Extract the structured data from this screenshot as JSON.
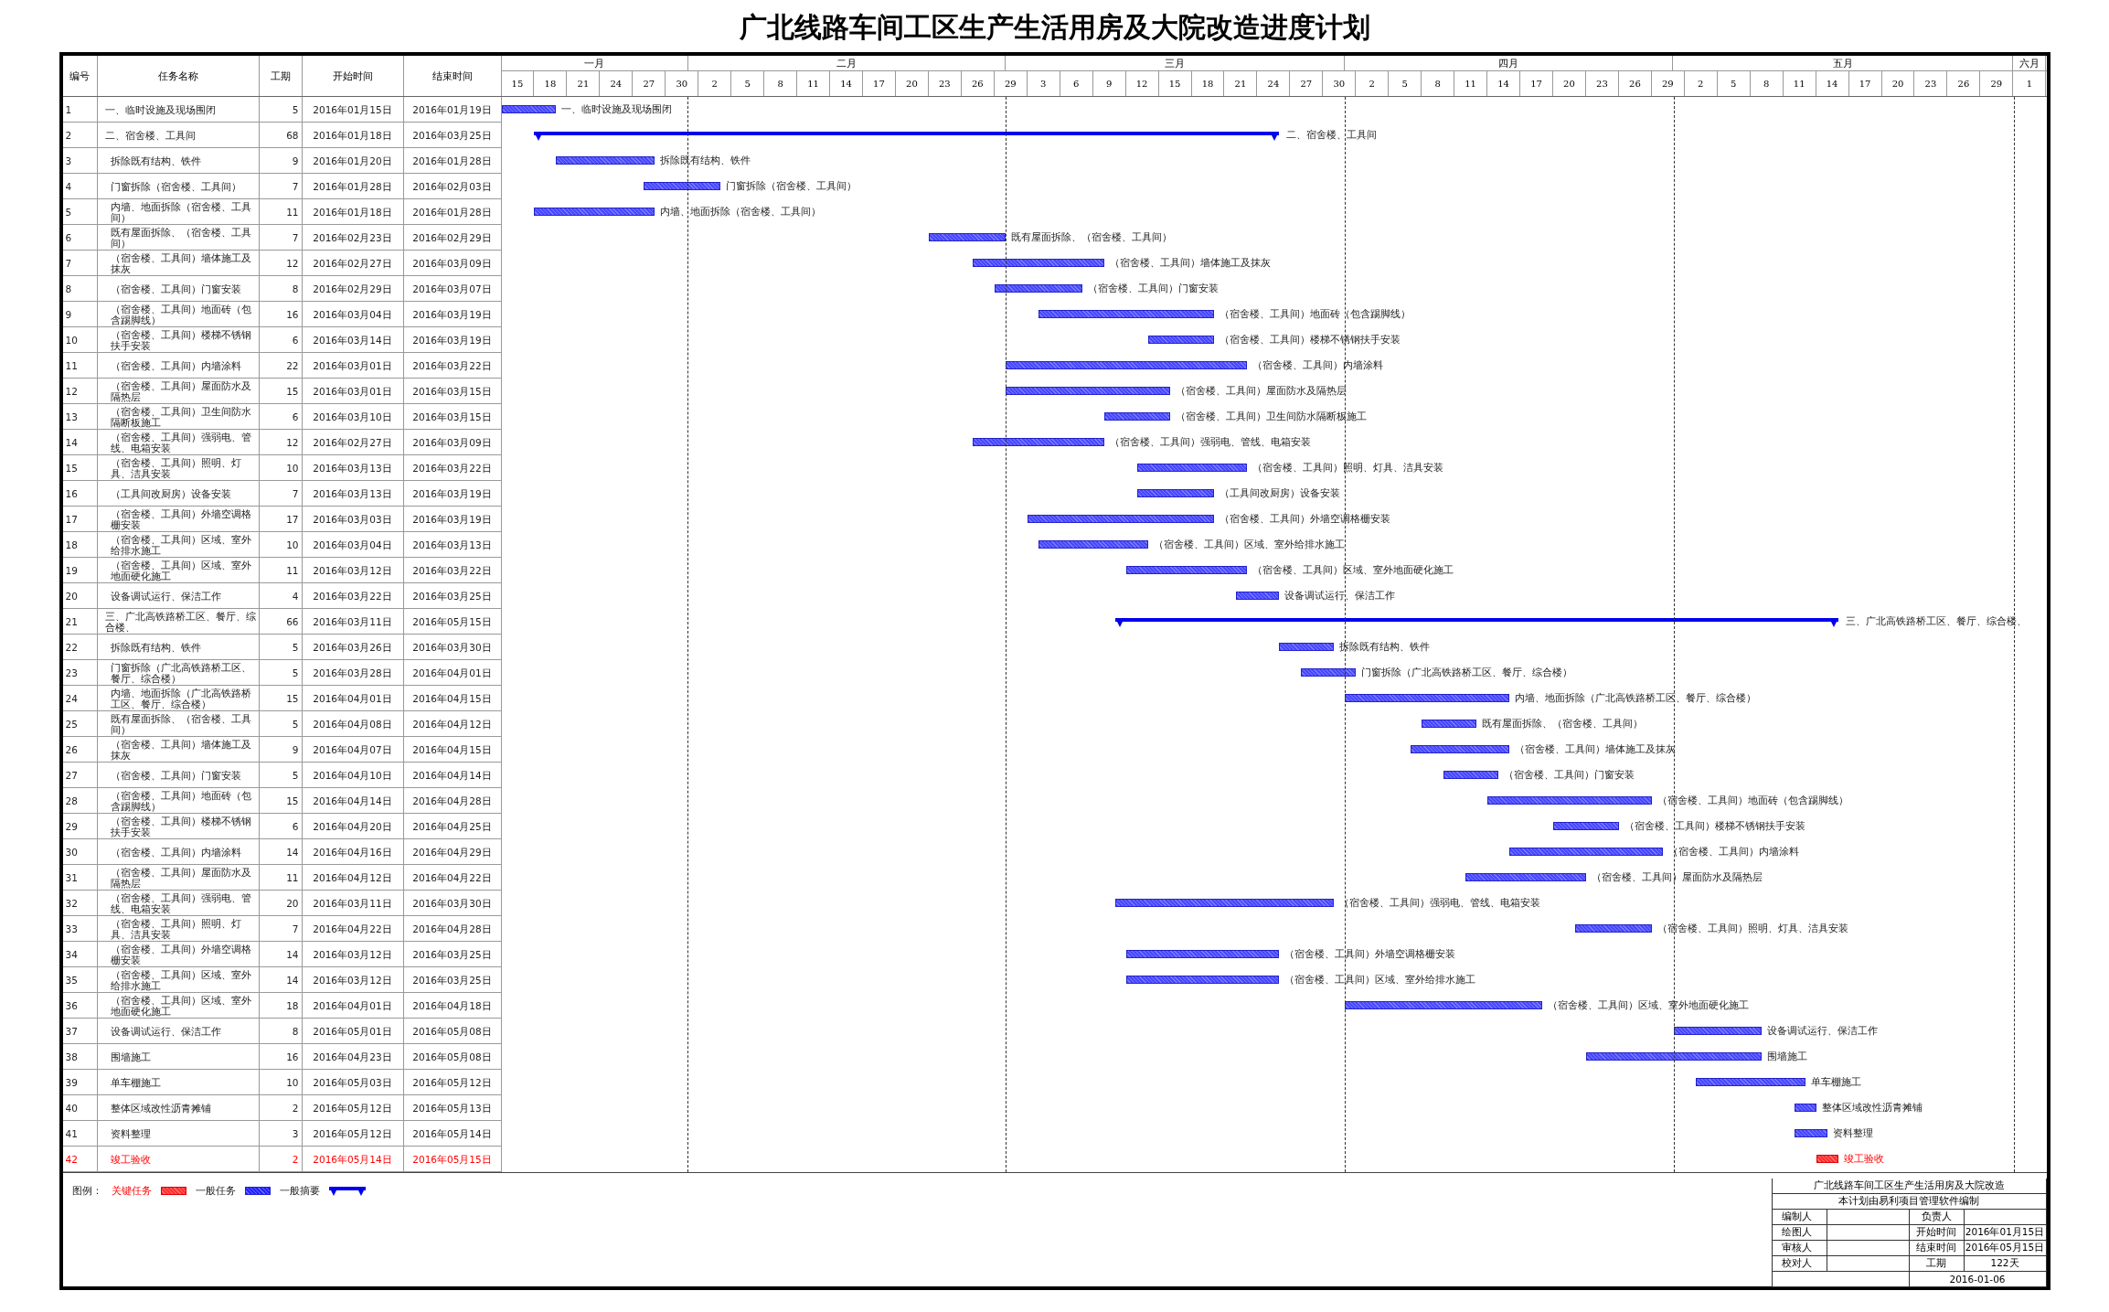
{
  "title": "广北线路车间工区生产生活用房及大院改造进度计划",
  "columns": [
    "编号",
    "任务名称",
    "工期",
    "开始时间",
    "结束时间"
  ],
  "timeline": {
    "months": [
      "一月",
      "二月",
      "三月",
      "四月",
      "五月",
      "六月"
    ],
    "days": [
      "15",
      "18",
      "21",
      "24",
      "27",
      "30",
      "2",
      "5",
      "8",
      "11",
      "14",
      "17",
      "20",
      "23",
      "26",
      "29",
      "3",
      "6",
      "9",
      "12",
      "15",
      "18",
      "21",
      "24",
      "27",
      "30",
      "2",
      "5",
      "8",
      "11",
      "14",
      "17",
      "20",
      "23",
      "26",
      "29",
      "2",
      "5",
      "8",
      "11",
      "14",
      "17",
      "20",
      "23",
      "26",
      "29",
      "1"
    ]
  },
  "tasks": [
    {
      "id": "1",
      "name": "一、临时设施及现场围闭",
      "duration": "5",
      "start": "2016年01月15日",
      "end": "2016年01月19日",
      "kind": "task",
      "bar_label": "一、临时设施及现场围闭"
    },
    {
      "id": "2",
      "name": "二、宿舍楼、工具间",
      "duration": "68",
      "start": "2016年01月18日",
      "end": "2016年03月25日",
      "kind": "summary",
      "bar_label": "二、宿舍楼、工具间",
      "children": [
        {
          "id": "3",
          "name": "拆除既有结构、铁件",
          "duration": "9",
          "start": "2016年01月20日",
          "end": "2016年01月28日",
          "kind": "task",
          "bar_label": "拆除既有结构、铁件"
        },
        {
          "id": "4",
          "name": "门窗拆除（宿舍楼、工具间）",
          "duration": "7",
          "start": "2016年01月28日",
          "end": "2016年02月03日",
          "kind": "task",
          "bar_label": "门窗拆除（宿舍楼、工具间）"
        },
        {
          "id": "5",
          "name": "内墙、地面拆除（宿舍楼、工具间）",
          "duration": "11",
          "start": "2016年01月18日",
          "end": "2016年01月28日",
          "kind": "task",
          "bar_label": "内墙、地面拆除（宿舍楼、工具间）"
        },
        {
          "id": "6",
          "name": "既有屋面拆除、（宿舍楼、工具间）",
          "duration": "7",
          "start": "2016年02月23日",
          "end": "2016年02月29日",
          "kind": "task",
          "bar_label": "既有屋面拆除、（宿舍楼、工具间）"
        },
        {
          "id": "7",
          "name": "（宿舍楼、工具间）墙体施工及抹灰",
          "duration": "12",
          "start": "2016年02月27日",
          "end": "2016年03月09日",
          "kind": "task",
          "bar_label": "（宿舍楼、工具间）墙体施工及抹灰"
        },
        {
          "id": "8",
          "name": "（宿舍楼、工具间）门窗安装",
          "duration": "8",
          "start": "2016年02月29日",
          "end": "2016年03月07日",
          "kind": "task",
          "bar_label": "（宿舍楼、工具间）门窗安装"
        },
        {
          "id": "9",
          "name": "（宿舍楼、工具间）地面砖（包含踢脚线）",
          "duration": "16",
          "start": "2016年03月04日",
          "end": "2016年03月19日",
          "kind": "task",
          "bar_label": "（宿舍楼、工具间）地面砖（包含踢脚线）"
        },
        {
          "id": "10",
          "name": "（宿舍楼、工具间）楼梯不锈钢扶手安装",
          "duration": "6",
          "start": "2016年03月14日",
          "end": "2016年03月19日",
          "kind": "task",
          "bar_label": "（宿舍楼、工具间）楼梯不锈钢扶手安装"
        },
        {
          "id": "11",
          "name": "（宿舍楼、工具间）内墙涂料",
          "duration": "22",
          "start": "2016年03月01日",
          "end": "2016年03月22日",
          "kind": "task",
          "bar_label": "（宿舍楼、工具间）内墙涂料"
        },
        {
          "id": "12",
          "name": "（宿舍楼、工具间）屋面防水及隔热层",
          "duration": "15",
          "start": "2016年03月01日",
          "end": "2016年03月15日",
          "kind": "task",
          "bar_label": "（宿舍楼、工具间）屋面防水及隔热层"
        },
        {
          "id": "13",
          "name": "（宿舍楼、工具间）卫生间防水隔断板施工",
          "duration": "6",
          "start": "2016年03月10日",
          "end": "2016年03月15日",
          "kind": "task",
          "bar_label": "（宿舍楼、工具间）卫生间防水隔断板施工"
        },
        {
          "id": "14",
          "name": "（宿舍楼、工具间）强弱电、管线、电箱安装",
          "duration": "12",
          "start": "2016年02月27日",
          "end": "2016年03月09日",
          "kind": "task",
          "bar_label": "（宿舍楼、工具间）强弱电、管线、电箱安装"
        },
        {
          "id": "15",
          "name": "（宿舍楼、工具间）照明、灯具、洁具安装",
          "duration": "10",
          "start": "2016年03月13日",
          "end": "2016年03月22日",
          "kind": "task",
          "bar_label": "（宿舍楼、工具间）照明、灯具、洁具安装"
        },
        {
          "id": "16",
          "name": "（工具间改厨房）设备安装",
          "duration": "7",
          "start": "2016年03月13日",
          "end": "2016年03月19日",
          "kind": "task",
          "bar_label": "（工具间改厨房）设备安装"
        },
        {
          "id": "17",
          "name": "（宿舍楼、工具间）外墙空调格栅安装",
          "duration": "17",
          "start": "2016年03月03日",
          "end": "2016年03月19日",
          "kind": "task",
          "bar_label": "（宿舍楼、工具间）外墙空调格栅安装"
        },
        {
          "id": "18",
          "name": "（宿舍楼、工具间）区域、室外给排水施工",
          "duration": "10",
          "start": "2016年03月04日",
          "end": "2016年03月13日",
          "kind": "task",
          "bar_label": "（宿舍楼、工具间）区域、室外给排水施工"
        },
        {
          "id": "19",
          "name": "（宿舍楼、工具间）区域、室外地面硬化施工",
          "duration": "11",
          "start": "2016年03月12日",
          "end": "2016年03月22日",
          "kind": "task",
          "bar_label": "（宿舍楼、工具间）区域、室外地面硬化施工"
        },
        {
          "id": "20",
          "name": "设备调试运行、保洁工作",
          "duration": "4",
          "start": "2016年03月22日",
          "end": "2016年03月25日",
          "kind": "task",
          "bar_label": "设备调试运行、保洁工作"
        }
      ]
    },
    {
      "id": "21",
      "name": "三、广北高铁路桥工区、餐厅、综合楼、",
      "duration": "66",
      "start": "2016年03月11日",
      "end": "2016年05月15日",
      "kind": "summary",
      "bar_label": "三、广北高铁路桥工区、餐厅、综合楼、",
      "children": [
        {
          "id": "22",
          "name": "拆除既有结构、铁件",
          "duration": "5",
          "start": "2016年03月26日",
          "end": "2016年03月30日",
          "kind": "task",
          "bar_label": "拆除既有结构、铁件"
        },
        {
          "id": "23",
          "name": "门窗拆除（广北高铁路桥工区、餐厅、综合楼）",
          "duration": "5",
          "start": "2016年03月28日",
          "end": "2016年04月01日",
          "kind": "task",
          "bar_label": "门窗拆除（广北高铁路桥工区、餐厅、综合楼）"
        },
        {
          "id": "24",
          "name": "内墙、地面拆除（广北高铁路桥工区、餐厅、综合楼）",
          "duration": "15",
          "start": "2016年04月01日",
          "end": "2016年04月15日",
          "kind": "task",
          "bar_label": "内墙、地面拆除（广北高铁路桥工区、餐厅、综合楼）"
        },
        {
          "id": "25",
          "name": "既有屋面拆除、（宿舍楼、工具间）",
          "duration": "5",
          "start": "2016年04月08日",
          "end": "2016年04月12日",
          "kind": "task",
          "bar_label": "既有屋面拆除、（宿舍楼、工具间）"
        },
        {
          "id": "26",
          "name": "（宿舍楼、工具间）墙体施工及抹灰",
          "duration": "9",
          "start": "2016年04月07日",
          "end": "2016年04月15日",
          "kind": "task",
          "bar_label": "（宿舍楼、工具间）墙体施工及抹灰"
        },
        {
          "id": "27",
          "name": "（宿舍楼、工具间）门窗安装",
          "duration": "5",
          "start": "2016年04月10日",
          "end": "2016年04月14日",
          "kind": "task",
          "bar_label": "（宿舍楼、工具间）门窗安装"
        },
        {
          "id": "28",
          "name": "（宿舍楼、工具间）地面砖（包含踢脚线）",
          "duration": "15",
          "start": "2016年04月14日",
          "end": "2016年04月28日",
          "kind": "task",
          "bar_label": "（宿舍楼、工具间）地面砖（包含踢脚线）"
        },
        {
          "id": "29",
          "name": "（宿舍楼、工具间）楼梯不锈钢扶手安装",
          "duration": "6",
          "start": "2016年04月20日",
          "end": "2016年04月25日",
          "kind": "task",
          "bar_label": "（宿舍楼、工具间）楼梯不锈钢扶手安装"
        },
        {
          "id": "30",
          "name": "（宿舍楼、工具间）内墙涂料",
          "duration": "14",
          "start": "2016年04月16日",
          "end": "2016年04月29日",
          "kind": "task",
          "bar_label": "（宿舍楼、工具间）内墙涂料"
        },
        {
          "id": "31",
          "name": "（宿舍楼、工具间）屋面防水及隔热层",
          "duration": "11",
          "start": "2016年04月12日",
          "end": "2016年04月22日",
          "kind": "task",
          "bar_label": "（宿舍楼、工具间）屋面防水及隔热层"
        },
        {
          "id": "32",
          "name": "（宿舍楼、工具间）强弱电、管线、电箱安装",
          "duration": "20",
          "start": "2016年03月11日",
          "end": "2016年03月30日",
          "kind": "task",
          "bar_label": "（宿舍楼、工具间）强弱电、管线、电箱安装"
        },
        {
          "id": "33",
          "name": "（宿舍楼、工具间）照明、灯具、洁具安装",
          "duration": "7",
          "start": "2016年04月22日",
          "end": "2016年04月28日",
          "kind": "task",
          "bar_label": "（宿舍楼、工具间）照明、灯具、洁具安装"
        },
        {
          "id": "34",
          "name": "（宿舍楼、工具间）外墙空调格栅安装",
          "duration": "14",
          "start": "2016年03月12日",
          "end": "2016年03月25日",
          "kind": "task",
          "bar_label": "（宿舍楼、工具间）外墙空调格栅安装"
        },
        {
          "id": "35",
          "name": "（宿舍楼、工具间）区域、室外给排水施工",
          "duration": "14",
          "start": "2016年03月12日",
          "end": "2016年03月25日",
          "kind": "task",
          "bar_label": "（宿舍楼、工具间）区域、室外给排水施工"
        },
        {
          "id": "36",
          "name": "（宿舍楼、工具间）区域、室外地面硬化施工",
          "duration": "18",
          "start": "2016年04月01日",
          "end": "2016年04月18日",
          "kind": "task",
          "bar_label": "（宿舍楼、工具间）区域、室外地面硬化施工"
        },
        {
          "id": "37",
          "name": "设备调试运行、保洁工作",
          "duration": "8",
          "start": "2016年05月01日",
          "end": "2016年05月08日",
          "kind": "task",
          "bar_label": "设备调试运行、保洁工作"
        },
        {
          "id": "38",
          "name": "围墙施工",
          "duration": "16",
          "start": "2016年04月23日",
          "end": "2016年05月08日",
          "kind": "task",
          "bar_label": "围墙施工"
        },
        {
          "id": "39",
          "name": "单车棚施工",
          "duration": "10",
          "start": "2016年05月03日",
          "end": "2016年05月12日",
          "kind": "task",
          "bar_label": "单车棚施工"
        },
        {
          "id": "40",
          "name": "整体区域改性沥青摊铺",
          "duration": "2",
          "start": "2016年05月12日",
          "end": "2016年05月13日",
          "kind": "task",
          "bar_label": "整体区域改性沥青摊铺"
        },
        {
          "id": "41",
          "name": "资料整理",
          "duration": "3",
          "start": "2016年05月12日",
          "end": "2016年05月14日",
          "kind": "task",
          "bar_label": "资料整理"
        },
        {
          "id": "42",
          "name": "竣工验收",
          "duration": "2",
          "start": "2016年05月14日",
          "end": "2016年05月15日",
          "kind": "critical",
          "bar_label": "竣工验收"
        }
      ]
    }
  ],
  "legend": {
    "title": "图例：",
    "items": [
      {
        "label": "关键任务",
        "kind": "critical"
      },
      {
        "label": "一般任务",
        "kind": "task"
      },
      {
        "label": "一般摘要",
        "kind": "summary"
      }
    ]
  },
  "info_box": {
    "project": "广北线路车间工区生产生活用房及大院改造",
    "note": "本计划由易利项目管理软件编制",
    "rows": [
      {
        "label": "编制人",
        "label_2": "负责人"
      },
      {
        "label": "绘图人",
        "label_2": "开始时间",
        "value_2": "2016年01月15日"
      },
      {
        "label": "审核人",
        "label_2": "结束时间",
        "value_2": "2016年05月15日"
      },
      {
        "label": "校对人",
        "label_2": "工期",
        "value_2": "122天"
      }
    ],
    "date": "2016-01-06"
  }
}
